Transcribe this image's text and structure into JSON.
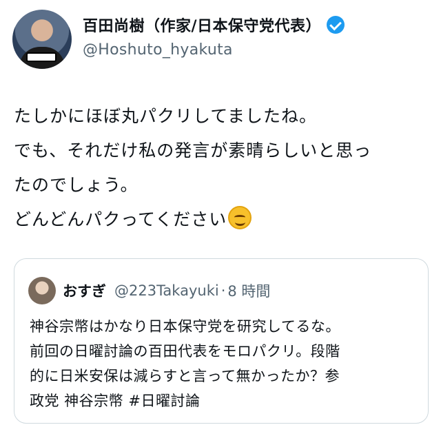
{
  "author": {
    "display_name": "百田尚樹（作家/日本保守党代表）",
    "handle": "@Hoshuto_hyakuta",
    "verified_icon": "verified-badge-icon",
    "accent_color": "#1d9bf0"
  },
  "tweet": {
    "lines": [
      "たしかにほぼ丸パクリしてましたね。",
      "でも、それだけ私の発言が素晴らしいと思っ",
      "たのでしょう。",
      "どんどんパクってください"
    ],
    "emoji": "smiling-face-icon"
  },
  "quoted_tweet": {
    "display_name": "おすぎ",
    "handle": "@223Takayuki",
    "separator": "·",
    "time": "8 時間",
    "lines": [
      "神谷宗幣はかなり日本保守党を研究してるな。",
      "前回の日曜討論の百田代表をモロパクリ。段階",
      "的に日米安保は減らすと言って無かったか？参",
      "政党 神谷宗幣 #日曜討論"
    ]
  }
}
